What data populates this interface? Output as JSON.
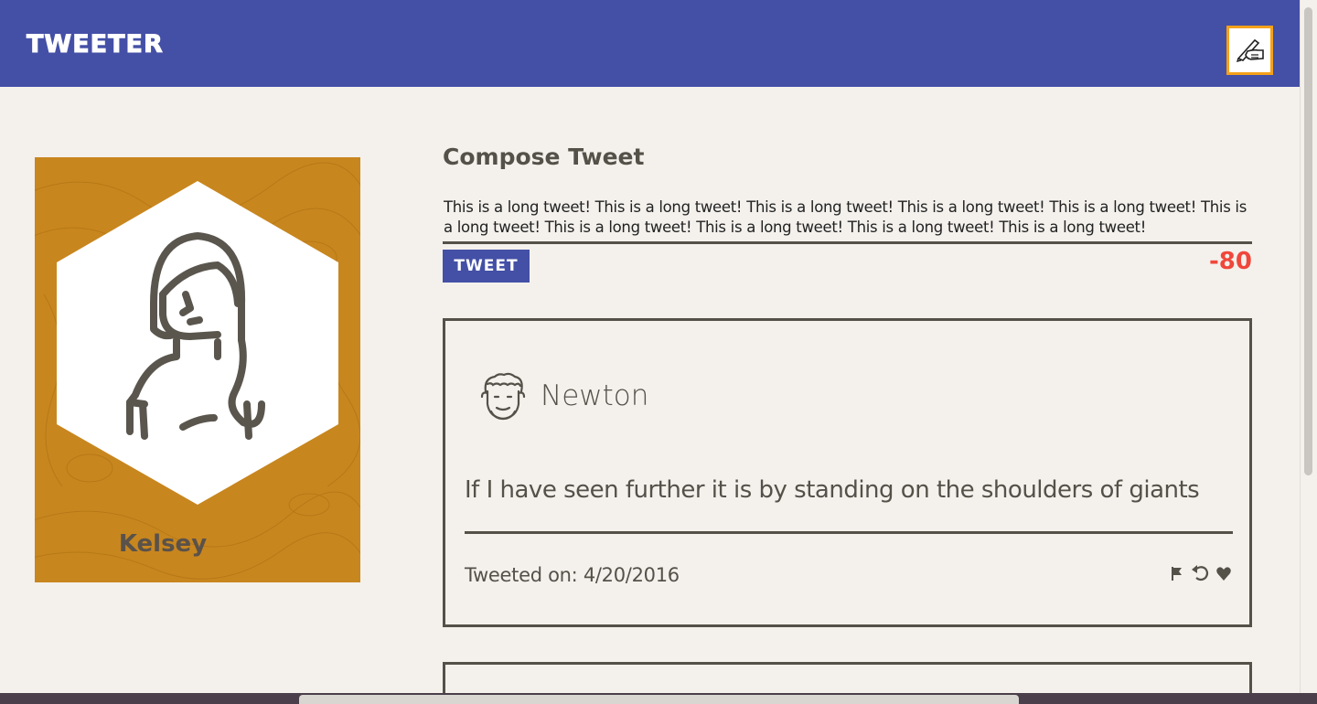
{
  "app": {
    "brand": "TWEETER",
    "compose_toggle_icon": "writing-hand-icon"
  },
  "profile": {
    "name": "Kelsey",
    "avatar": "woman-avatar-icon",
    "background_color": "#c8861e"
  },
  "compose": {
    "title": "Compose Tweet",
    "text": "This is a long tweet! This is a long tweet! This is a long tweet! This is a long tweet! This is a long tweet! This is a long tweet! This is a long tweet! This is a long tweet! This is a long tweet! This is a long tweet!",
    "button_label": "TWEET",
    "counter": "-80"
  },
  "tweets": [
    {
      "author": "Newton",
      "avatar": "curly-hair-man-avatar-icon",
      "body": "If I have seen further it is by standing on the shoulders of giants",
      "date": "Tweeted on: 4/20/2016",
      "actions": [
        "flag-icon",
        "retweet-icon",
        "heart-icon"
      ]
    }
  ],
  "colors": {
    "nav": "#4450a6",
    "accent": "#f5a11a",
    "counter": "#f0473b",
    "text": "#545149",
    "page": "#f4f1ed"
  }
}
